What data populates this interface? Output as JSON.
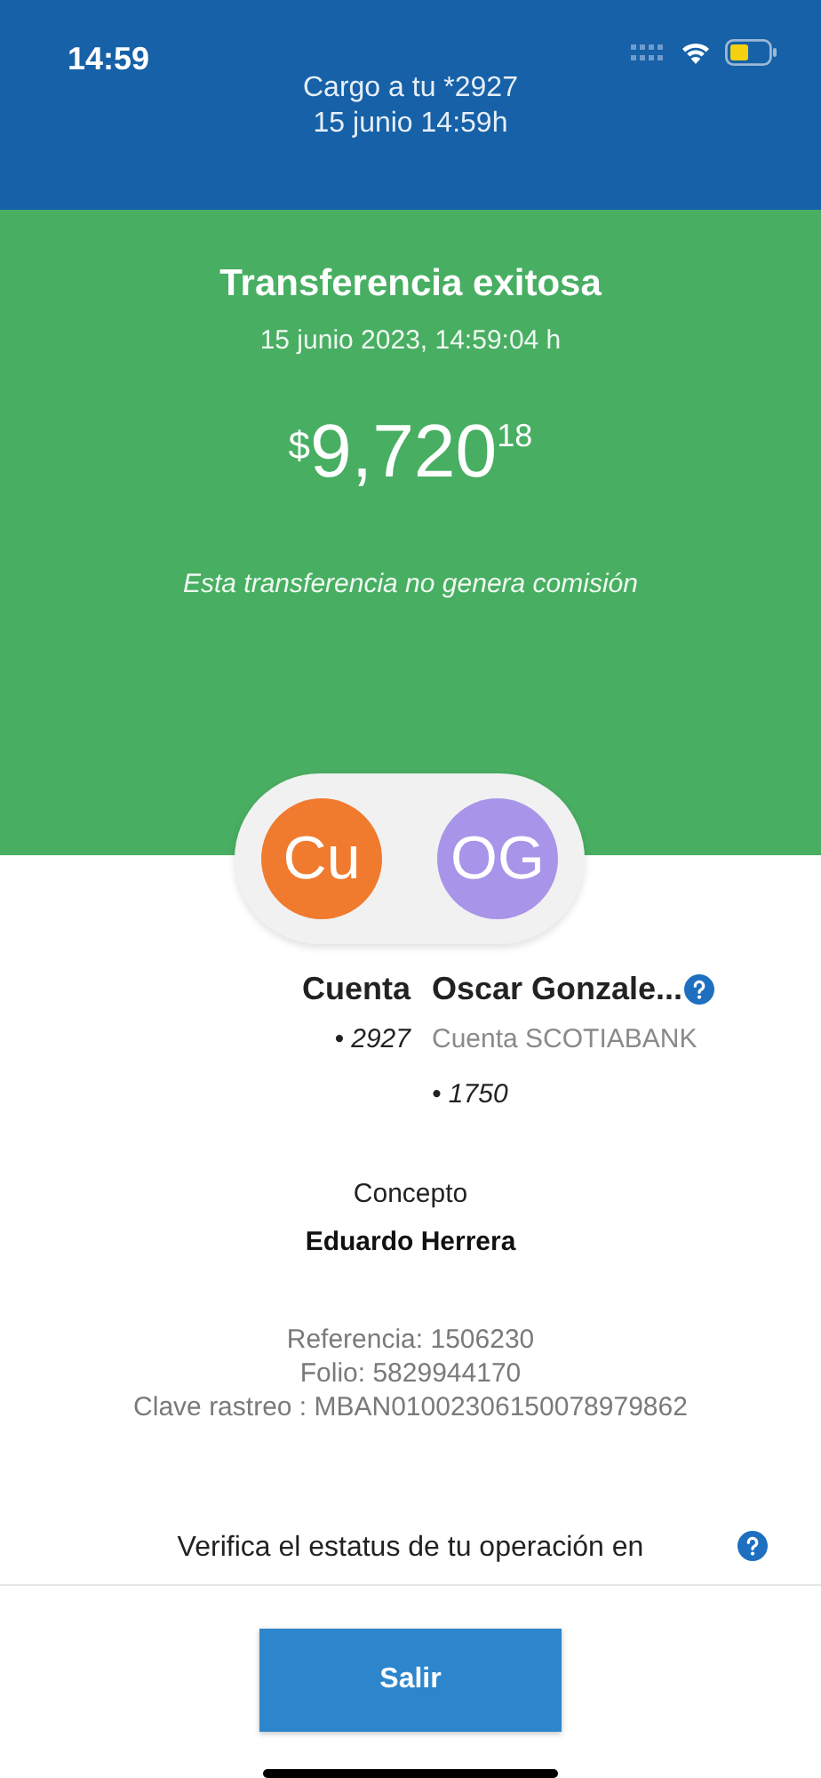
{
  "status_bar": {
    "time": "14:59"
  },
  "header": {
    "line_1": "Cargo a tu *2927",
    "line_2": "15 junio 14:59h"
  },
  "result": {
    "title": "Transferencia exitosa",
    "date": "15 junio 2023, 14:59:04 h",
    "currency": "$",
    "amount": "9,720",
    "cents": "18",
    "note": "Esta transferencia no genera comisión"
  },
  "parties": [
    {
      "initials": "Cu",
      "color": "#f07a2e",
      "name": "Cuenta",
      "account": "• 2927",
      "help": false
    },
    {
      "initials": "OG",
      "color": "#a894e8",
      "name": "Oscar Gonzale...",
      "bank": "Cuenta SCOTIABANK",
      "account": "• 1750",
      "help": true
    }
  ],
  "concept": {
    "label": "Concepto",
    "value": "Eduardo Herrera"
  },
  "details": [
    "Referencia: 1506230",
    "Folio: 5829944170",
    "Clave rastreo : MBAN01002306150078979862"
  ],
  "verify": {
    "text": "Verifica el estatus de tu operación en"
  },
  "buttons": [
    {
      "label": "Salir"
    }
  ]
}
